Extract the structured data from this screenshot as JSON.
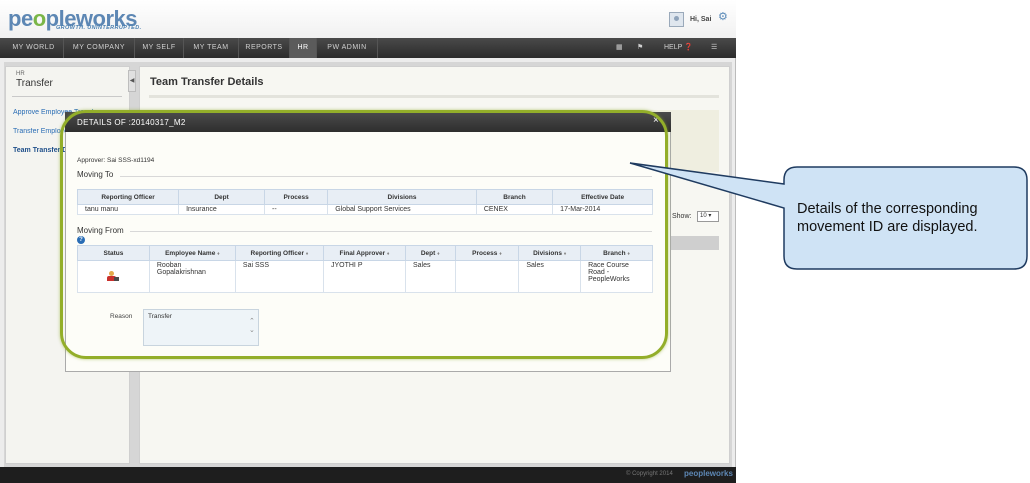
{
  "header": {
    "logo_text_1": "pe",
    "logo_text_o": "o",
    "logo_text_2": "pleworks",
    "tagline": "GROWTH. UNINTERRUPTED.",
    "greeting": "Hi, Sai"
  },
  "nav": {
    "items": [
      {
        "label": "MY WORLD"
      },
      {
        "label": "MY COMPANY"
      },
      {
        "label": "MY SELF"
      },
      {
        "label": "MY TEAM"
      },
      {
        "label": "REPORTS"
      },
      {
        "label": "HR"
      },
      {
        "label": "PW ADMIN"
      }
    ],
    "help_label": "HELP"
  },
  "sidebar": {
    "kicker": "HR",
    "title": "Transfer",
    "links": [
      {
        "label": "Approve Employee Transfer"
      },
      {
        "label": "Transfer Employee"
      },
      {
        "label": "Team Transfer Details"
      }
    ]
  },
  "main": {
    "title": "Team Transfer Details",
    "show_label": "Show:",
    "show_value": "10"
  },
  "modal": {
    "title": "DETAILS OF :20140317_M2",
    "close_glyph": "×",
    "approver": "Approver: Sai SSS-xd1194",
    "moving_to": {
      "title": "Moving To",
      "columns": [
        "Reporting Officer",
        "Dept",
        "Process",
        "Divisions",
        "Branch",
        "Effective Date"
      ],
      "row": [
        "tanu manu",
        "Insurance",
        "--",
        "Global Support Services",
        "CENEX",
        "17-Mar-2014"
      ]
    },
    "moving_from": {
      "title": "Moving From",
      "columns": [
        "Status",
        "Employee Name",
        "Reporting Officer",
        "Final Approver",
        "Dept",
        "Process",
        "Divisions",
        "Branch"
      ],
      "row": {
        "status_icon": "user-status-icon",
        "employee_name": "Rooban Gopalakrishnan",
        "reporting_officer": "Sai SSS",
        "final_approver": "JYOTHI P",
        "dept": "Sales",
        "process": "",
        "divisions": "Sales",
        "branch": "Race Course Road - PeopleWorks"
      }
    },
    "reason_label": "Reason",
    "reason_value": "Transfer"
  },
  "footer": {
    "copyright": "© Copyright 2014",
    "logo": "peopleworks"
  },
  "callout": {
    "text": "Details of the corresponding movement ID are displayed."
  },
  "colors": {
    "highlight": "#93ae2a",
    "callout_fill": "#cfe3f5",
    "callout_border": "#1f3b60",
    "nav_bg": "#2b2b2b",
    "link": "#2a6db5"
  }
}
